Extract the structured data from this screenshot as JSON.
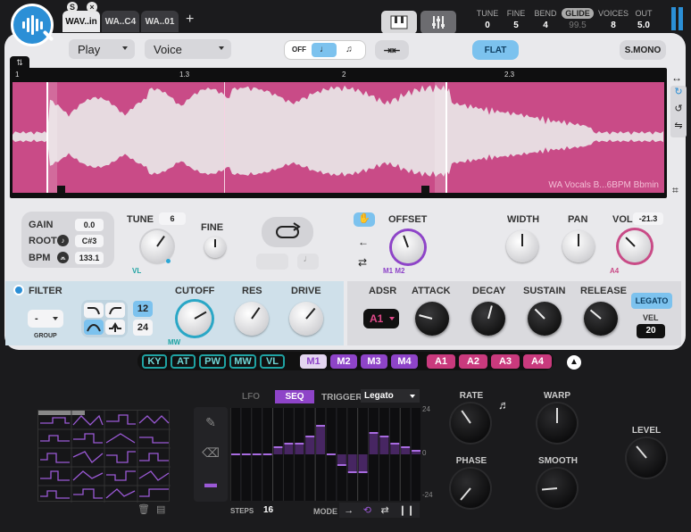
{
  "tabs": [
    {
      "label": "WAV..in",
      "selected": true,
      "badge": "S"
    },
    {
      "label": "WA..C4",
      "selected": false
    },
    {
      "label": "WA..01",
      "selected": false
    }
  ],
  "add_tab": "+",
  "header": {
    "params": [
      {
        "label": "TUNE",
        "value": "0"
      },
      {
        "label": "FINE",
        "value": "5"
      },
      {
        "label": "BEND",
        "value": "4"
      },
      {
        "label": "GLIDE",
        "value": "99.5"
      },
      {
        "label": "VOICES",
        "value": "8"
      },
      {
        "label": "OUT",
        "value": "5.0"
      }
    ]
  },
  "controls": {
    "play_mode": "Play",
    "voice_mode": "Voice",
    "off_label": "OFF",
    "flat_label": "FLAT",
    "smono_label": "S.MONO"
  },
  "waveform": {
    "ruler": [
      "1",
      "1.3",
      "2",
      "2.3"
    ],
    "sample_name": "WA Vocals B...6BPM Bbmin"
  },
  "sample_info": {
    "gain_label": "GAIN",
    "gain_value": "0.0",
    "root_label": "ROOT",
    "root_value": "C#3",
    "bpm_label": "BPM",
    "bpm_value": "133.1"
  },
  "pitch": {
    "tune_label": "TUNE",
    "tune_value": "6",
    "fine_label": "FINE",
    "tune_mod": "VL"
  },
  "offset": {
    "label": "OFFSET",
    "mods": [
      "M1",
      "M2"
    ]
  },
  "mix": {
    "width_label": "WIDTH",
    "pan_label": "PAN",
    "vol_label": "VOL",
    "vol_value": "-21.3",
    "vol_mod": "A4"
  },
  "filter": {
    "label": "FILTER",
    "group_label": "GROUP",
    "group_value": "-",
    "slopes": [
      "12",
      "24"
    ],
    "cutoff_label": "CUTOFF",
    "cutoff_mod": "MW",
    "res_label": "RES",
    "drive_label": "DRIVE"
  },
  "adsr": {
    "label": "ADSR",
    "target": "A1",
    "attack": "ATTACK",
    "decay": "DECAY",
    "sustain": "SUSTAIN",
    "release": "RELEASE",
    "legato_label": "LEGATO",
    "vel_label": "VEL",
    "vel_value": "20"
  },
  "mod_sources": {
    "teal": [
      "KY",
      "AT",
      "PW",
      "MW",
      "VL"
    ],
    "purple": [
      "M1",
      "M2",
      "M3",
      "M4"
    ],
    "pink": [
      "A1",
      "A2",
      "A3",
      "A4"
    ]
  },
  "lfo": {
    "tab_lfo": "LFO",
    "tab_seq": "SEQ",
    "trigger_label": "TRIGGER",
    "trigger_value": "Legato",
    "steps_label": "STEPS",
    "steps_value": "16",
    "mode_label": "MODE",
    "axis": [
      "24",
      "0",
      "-24"
    ],
    "seq_values": [
      0,
      0,
      0,
      0,
      4,
      6,
      6,
      10,
      16,
      0,
      -6,
      -10,
      -10,
      12,
      10,
      6,
      4,
      2
    ]
  },
  "lfo_knobs": {
    "rate": "RATE",
    "warp": "WARP",
    "phase": "PHASE",
    "smooth": "SMOOTH",
    "level": "LEVEL"
  },
  "colors": {
    "accent": "#2b8fd6",
    "wave_bg": "#c94b87",
    "purple": "#8e44c8",
    "teal": "#1fa3a3"
  }
}
